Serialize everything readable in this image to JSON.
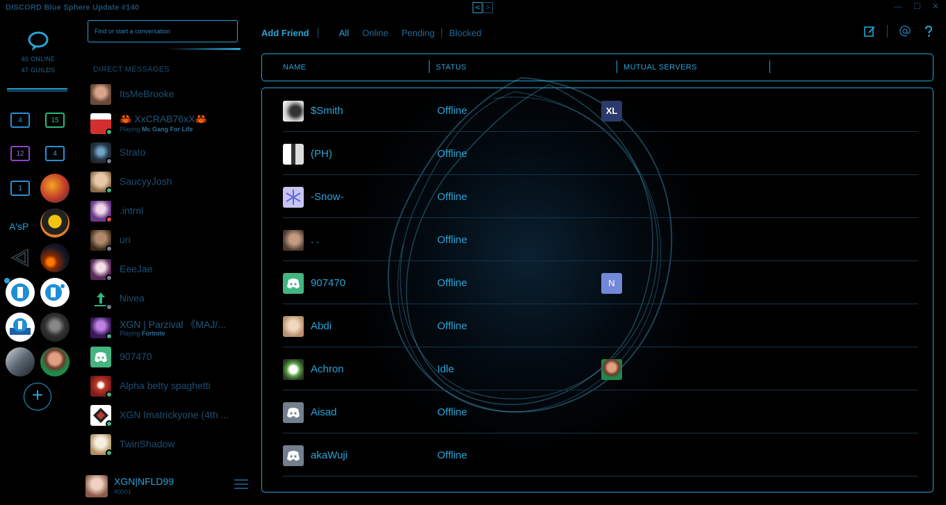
{
  "window": {
    "title": "DISCORD Blue Sphere Update #140"
  },
  "nav": {
    "back": "<",
    "forward": ">"
  },
  "window_controls": {
    "minimize": "—",
    "maximize": "☐",
    "close": "✕"
  },
  "home": {
    "online": "40 ONLINE",
    "guilds": "47 GUILDS"
  },
  "folders": [
    "4",
    "15",
    "12",
    "4",
    "1"
  ],
  "text_guild": "A'sP",
  "add_server": "+",
  "search": {
    "placeholder": "Find or start a conversation"
  },
  "dm_header": "DIRECT MESSAGES",
  "dms": [
    {
      "name": "ItsMeBrooke",
      "status": "none"
    },
    {
      "name": "🦀 XxCRAB76xX🦀",
      "status": "online",
      "playing_prefix": "Playing",
      "playing": "Mc Gang For Life"
    },
    {
      "name": "Strato",
      "status": "offline"
    },
    {
      "name": "SaucyyJosh",
      "status": "online"
    },
    {
      "name": ".intrnl",
      "status": "dnd"
    },
    {
      "name": "uri",
      "status": "offline"
    },
    {
      "name": "EeeJae",
      "status": "offline"
    },
    {
      "name": "Nivea",
      "status": "offline"
    },
    {
      "name": "XGN | Parzival 《MAJ/...",
      "status": "online",
      "playing_prefix": "Playing",
      "playing": "Fortnite"
    },
    {
      "name": "907470",
      "status": "none"
    },
    {
      "name": "Alpha betty spaghetti",
      "status": "online"
    },
    {
      "name": "XGN Imatrickyone (4th ...",
      "status": "online"
    },
    {
      "name": "TwinShadow",
      "status": "online"
    }
  ],
  "user": {
    "name": "XGN|NFLD99",
    "tag": "#0001"
  },
  "tabs": {
    "add_friend": "Add Friend",
    "all": "All",
    "online": "Online",
    "pending": "Pending",
    "blocked": "Blocked"
  },
  "top_icons": [
    "new-dm-icon",
    "mention-icon",
    "help-icon"
  ],
  "columns": {
    "name": "NAME",
    "status": "STATUS",
    "mutual": "MUTUAL SERVERS"
  },
  "friends": [
    {
      "name": "$Smith",
      "status": "Offline",
      "server": "XL"
    },
    {
      "name": "(PH)",
      "status": "Offline",
      "server": ""
    },
    {
      "name": "-Snow-",
      "status": "Offline",
      "server": ""
    },
    {
      "name": ". .",
      "status": "Offline",
      "server": ""
    },
    {
      "name": "907470",
      "status": "Offline",
      "server": "N"
    },
    {
      "name": "Abdi",
      "status": "Offline",
      "server": ""
    },
    {
      "name": "Achron",
      "status": "Idle",
      "server": "avatar"
    },
    {
      "name": "Aisad",
      "status": "Offline",
      "server": ""
    },
    {
      "name": "akaWuji",
      "status": "Offline",
      "server": ""
    }
  ],
  "colors": {
    "accent": "#2aa3d6",
    "dim": "#1b4f73",
    "online": "#43b581",
    "offline": "#747f8d",
    "dnd": "#f04747",
    "blurple": "#7289da"
  }
}
